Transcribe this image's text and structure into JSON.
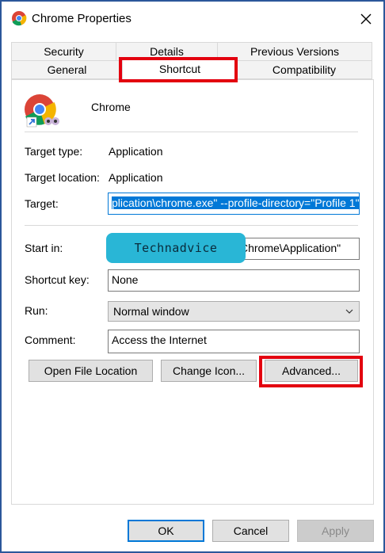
{
  "window": {
    "title": "Chrome Properties"
  },
  "tabs": {
    "row1": [
      {
        "label": "Security"
      },
      {
        "label": "Details"
      },
      {
        "label": "Previous Versions"
      }
    ],
    "row2": [
      {
        "label": "General"
      },
      {
        "label": "Shortcut"
      },
      {
        "label": "Compatibility"
      }
    ],
    "active": "Shortcut"
  },
  "shortcut": {
    "name": "Chrome",
    "target_type_label": "Target type:",
    "target_type_value": "Application",
    "target_location_label": "Target location:",
    "target_location_value": "Application",
    "target_label": "Target:",
    "target_value": "plication\\chrome.exe\" --profile-directory=\"Profile 1\"",
    "start_in_label": "Start in:",
    "start_in_value": "Chrome\\Application\"",
    "shortcut_key_label": "Shortcut key:",
    "shortcut_key_value": "None",
    "run_label": "Run:",
    "run_value": "Normal window",
    "comment_label": "Comment:",
    "comment_value": "Access the Internet"
  },
  "buttons": {
    "open_file_location": "Open File Location",
    "change_icon": "Change Icon...",
    "advanced": "Advanced...",
    "ok": "OK",
    "cancel": "Cancel",
    "apply": "Apply"
  },
  "watermark": {
    "text": "Technadvice"
  },
  "colors": {
    "highlight": "#e3000f",
    "accent": "#0078d7",
    "watermark_bg": "#29b6d6"
  },
  "icons": {
    "app": "chrome-logo-icon",
    "close": "close-icon",
    "dropdown": "chevron-down-icon"
  }
}
